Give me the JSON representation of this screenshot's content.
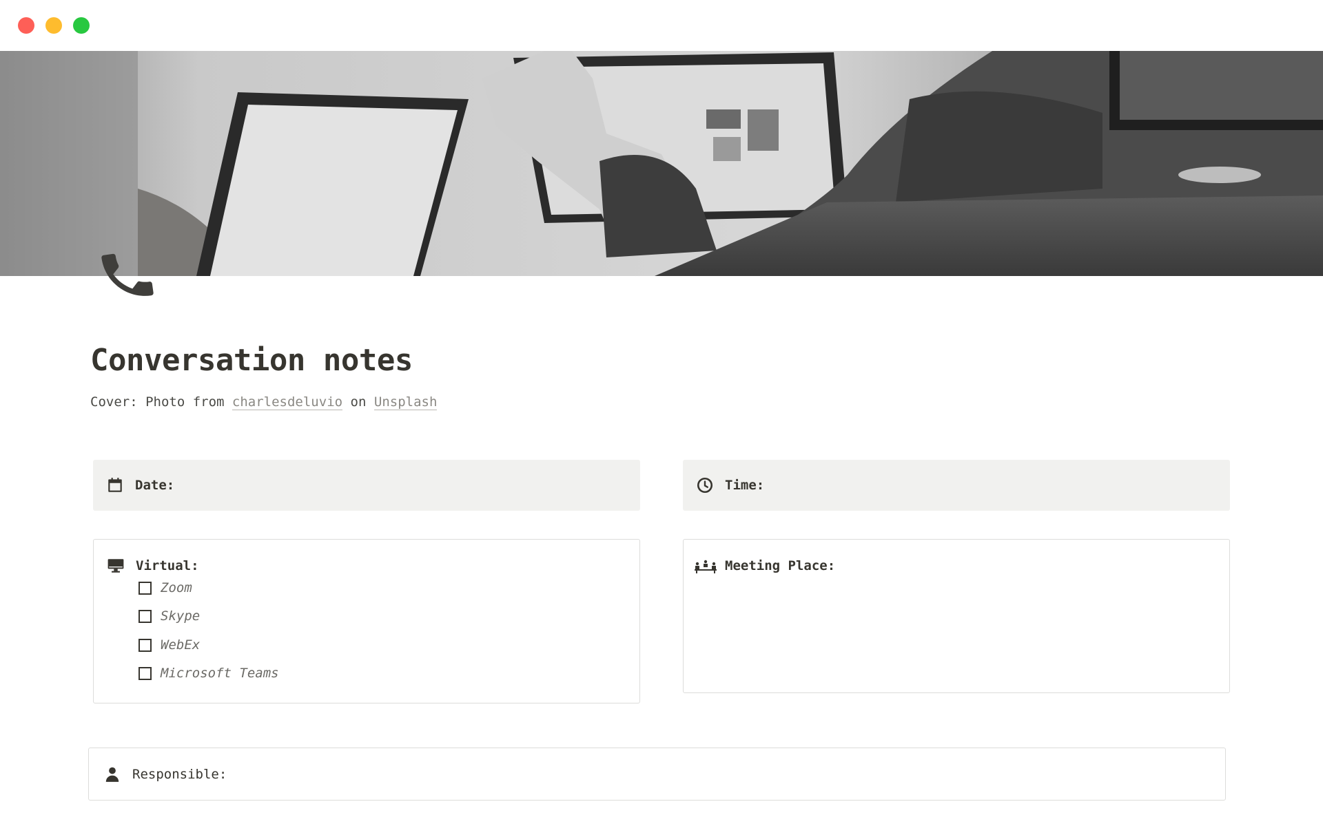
{
  "window": {
    "controls": [
      "close",
      "minimize",
      "zoom"
    ]
  },
  "cover": {
    "image": "black-and-white photo of people working on laptops at a desk"
  },
  "page": {
    "icon": "telephone-receiver-icon",
    "title": "Conversation notes",
    "credit": {
      "prefix": "Cover: Photo from",
      "author": "charlesdeluvio",
      "middle": "on",
      "source": "Unsplash"
    }
  },
  "date_card": {
    "icon": "calendar-icon",
    "label": "Date:"
  },
  "time_card": {
    "icon": "clock-icon",
    "label": "Time:"
  },
  "virtual_card": {
    "icon": "desktop-computer-icon",
    "label": "Virtual:",
    "options": [
      {
        "label": "Zoom",
        "checked": false
      },
      {
        "label": "Skype",
        "checked": false
      },
      {
        "label": "WebEx",
        "checked": false
      },
      {
        "label": "Microsoft Teams",
        "checked": false
      }
    ]
  },
  "meeting_place_card": {
    "icon": "people-at-table-icon",
    "label": "Meeting Place:"
  },
  "responsible_card": {
    "icon": "person-icon",
    "label": "Responsible:"
  },
  "colors": {
    "text": "#37352f",
    "muted_text": "#6b6a66",
    "callout_gray": "#f1f1ef",
    "border": "#dcdcda",
    "close": "#fe5f57",
    "minimize": "#febc2e",
    "zoom": "#28c840"
  }
}
